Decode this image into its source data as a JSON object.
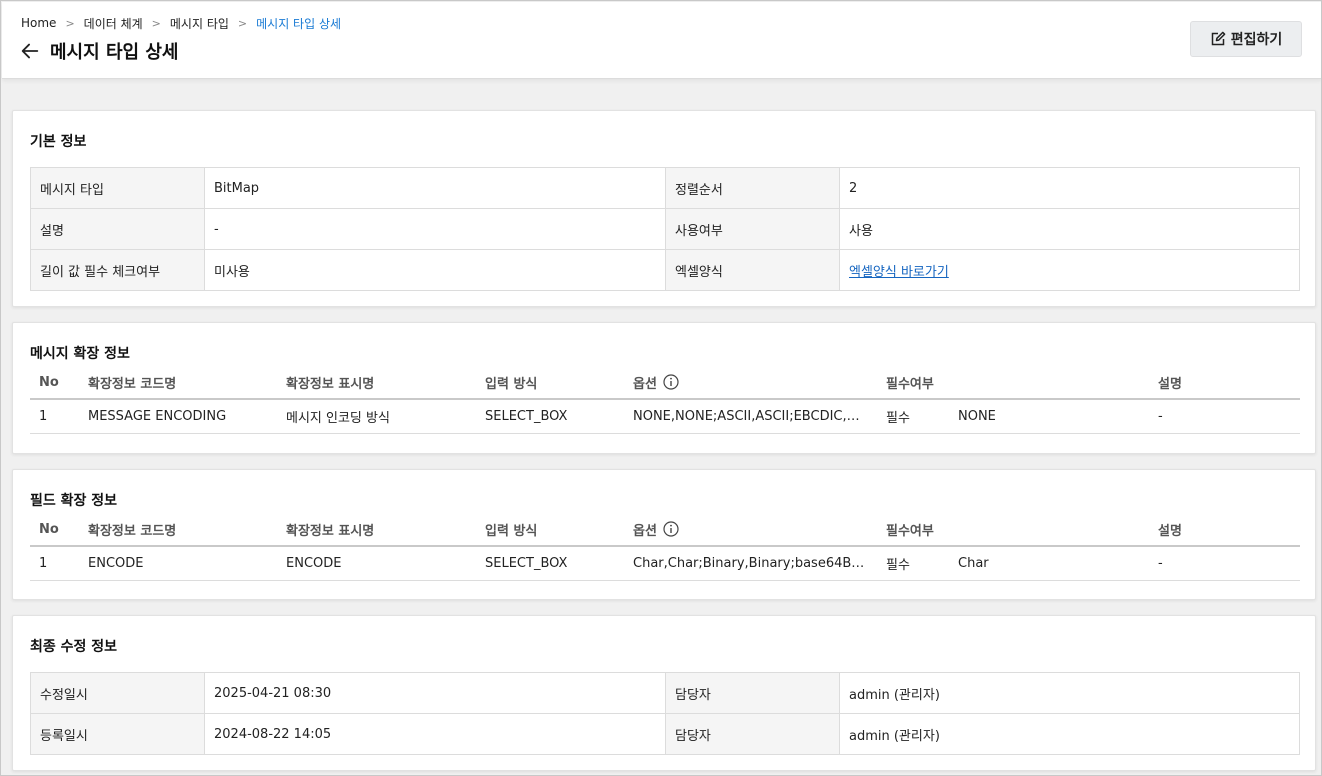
{
  "breadcrumb": [
    "Home",
    "데이터 체계",
    "메시지 타입",
    "메시지 타입 상세"
  ],
  "page_title": "메시지 타입 상세",
  "edit_button": "편집하기",
  "basic_info": {
    "title": "기본 정보",
    "rows": [
      {
        "label1": "메시지 타입",
        "value1": "BitMap",
        "label2": "정렬순서",
        "value2": "2"
      },
      {
        "label1": "설명",
        "value1": "-",
        "label2": "사용여부",
        "value2": "사용"
      },
      {
        "label1": "길이 값 필수 체크여부",
        "value1": "미사용",
        "label2": "엑셀양식",
        "value2": "엑셀양식 바로가기"
      }
    ]
  },
  "columns": {
    "no": "No",
    "code": "확장정보 코드명",
    "display": "확장정보 표시명",
    "input": "입력 방식",
    "option": "옵션",
    "required": "필수여부",
    "desc": "설명"
  },
  "message_ext": {
    "title": "메시지 확장 정보",
    "rows": [
      {
        "no": "1",
        "code": "MESSAGE ENCODING",
        "display": "메시지 인코딩 방식",
        "input": "SELECT_BOX",
        "option": "NONE,NONE;ASCII,ASCII;EBCDIC,EB…",
        "required": "필수",
        "default": "NONE",
        "desc": "-"
      }
    ]
  },
  "field_ext": {
    "title": "필드 확장 정보",
    "rows": [
      {
        "no": "1",
        "code": "ENCODE",
        "display": "ENCODE",
        "input": "SELECT_BOX",
        "option": "Char,Char;Binary,Binary;base64Bin…",
        "required": "필수",
        "default": "Char",
        "desc": "-"
      }
    ]
  },
  "last_modified": {
    "title": "최종 수정 정보",
    "rows": [
      {
        "label1": "수정일시",
        "value1": "2025-04-21 08:30",
        "label2": "담당자",
        "value2": "admin (관리자)"
      },
      {
        "label1": "등록일시",
        "value1": "2024-08-22 14:05",
        "label2": "담당자",
        "value2": "admin (관리자)"
      }
    ]
  },
  "colors": {
    "accent": "#1a7bd4",
    "link": "#1565c0"
  }
}
